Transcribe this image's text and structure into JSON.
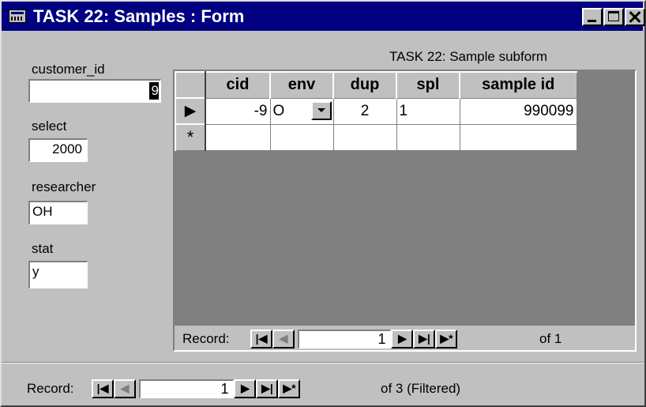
{
  "window": {
    "title": "TASK 22: Samples : Form"
  },
  "form": {
    "customer_id": {
      "label": "customer_id",
      "value": "",
      "selected_char": "9"
    },
    "select": {
      "label": "select",
      "value": "2000"
    },
    "researcher": {
      "label": "researcher",
      "value": "OH"
    },
    "stat": {
      "label": "stat",
      "value": "y"
    }
  },
  "subform": {
    "caption": "TASK 22: Sample subform",
    "columns": [
      "cid",
      "env",
      "dup",
      "spl",
      "sample id"
    ],
    "rows": [
      {
        "cid": "-9",
        "env": "O",
        "dup": "2",
        "spl": "1",
        "sample_id": "990099"
      }
    ],
    "new_row_marker": "*",
    "current_row_marker": "▶",
    "nav": {
      "label": "Record:",
      "current": "1",
      "total_text": "of  1"
    }
  },
  "main_nav": {
    "label": "Record:",
    "current": "1",
    "total_text": "of  3 (Filtered)"
  },
  "colors": {
    "titlebar": "#000080",
    "face": "#c0c0c0",
    "field": "#ffffff"
  }
}
